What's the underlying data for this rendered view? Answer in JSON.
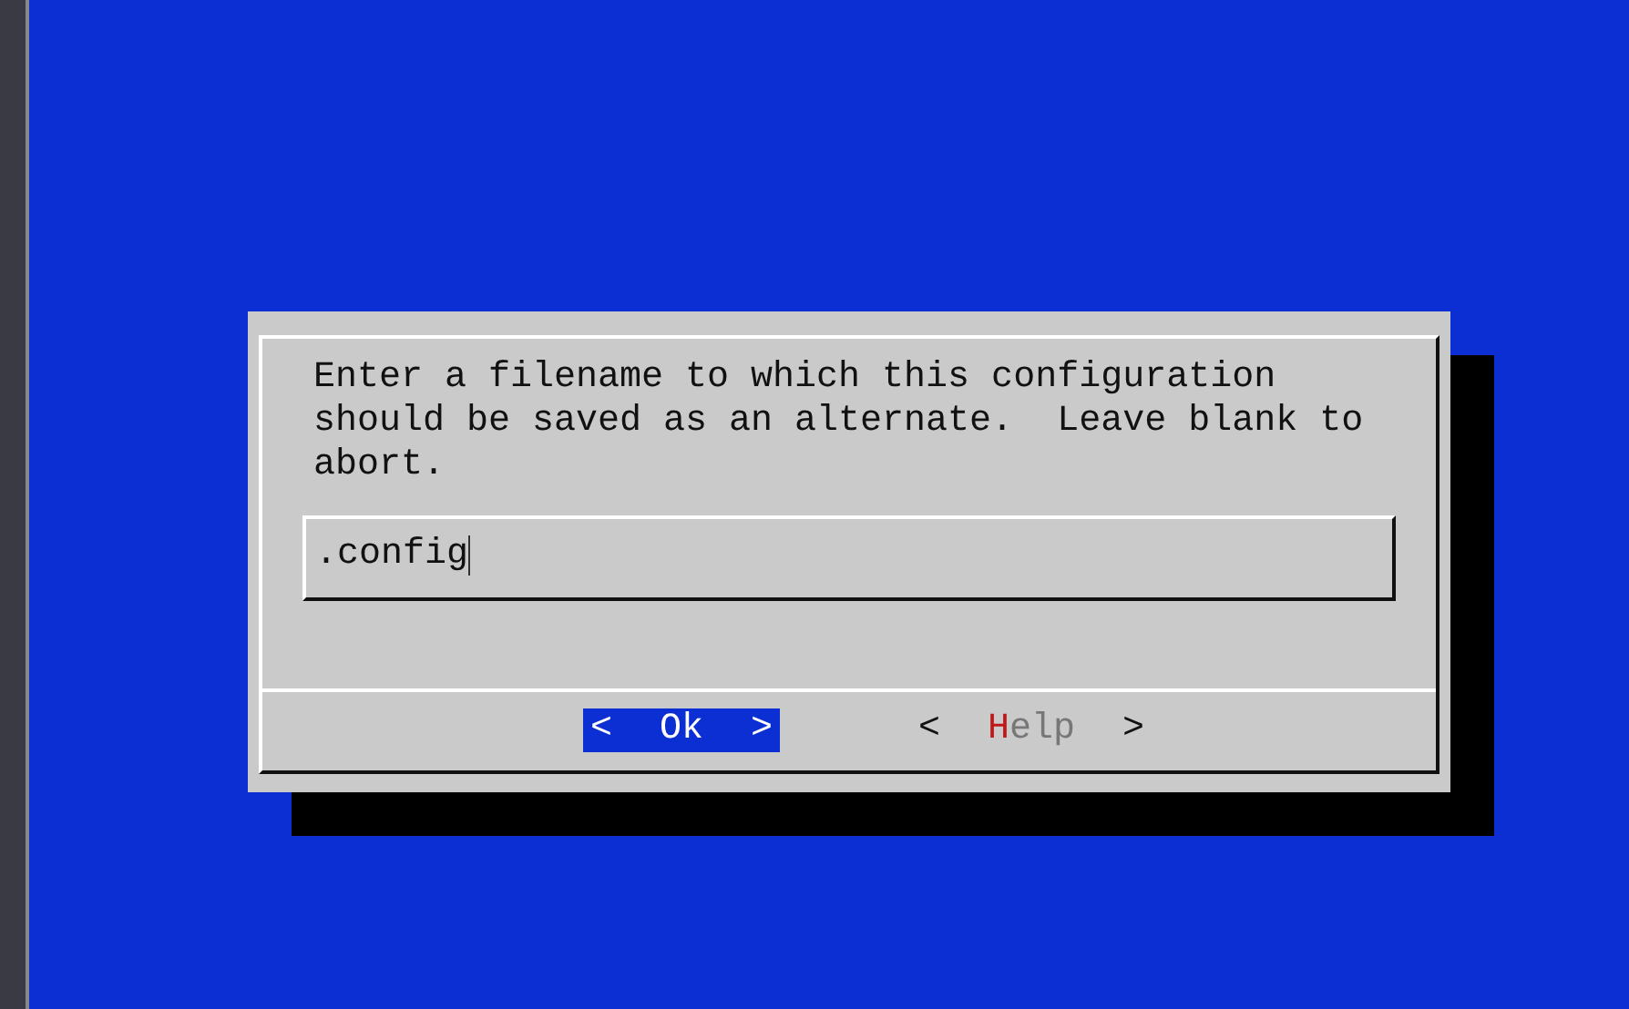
{
  "dialog": {
    "message": "Enter a filename to which this configuration should be saved as an alternate.  Leave blank to abort.",
    "input": {
      "value": ".config"
    },
    "buttons": [
      {
        "open": "<",
        "label": "Ok",
        "close": ">",
        "selected": true
      },
      {
        "open": "<",
        "label": "Help",
        "close": ">",
        "selected": false
      }
    ]
  }
}
